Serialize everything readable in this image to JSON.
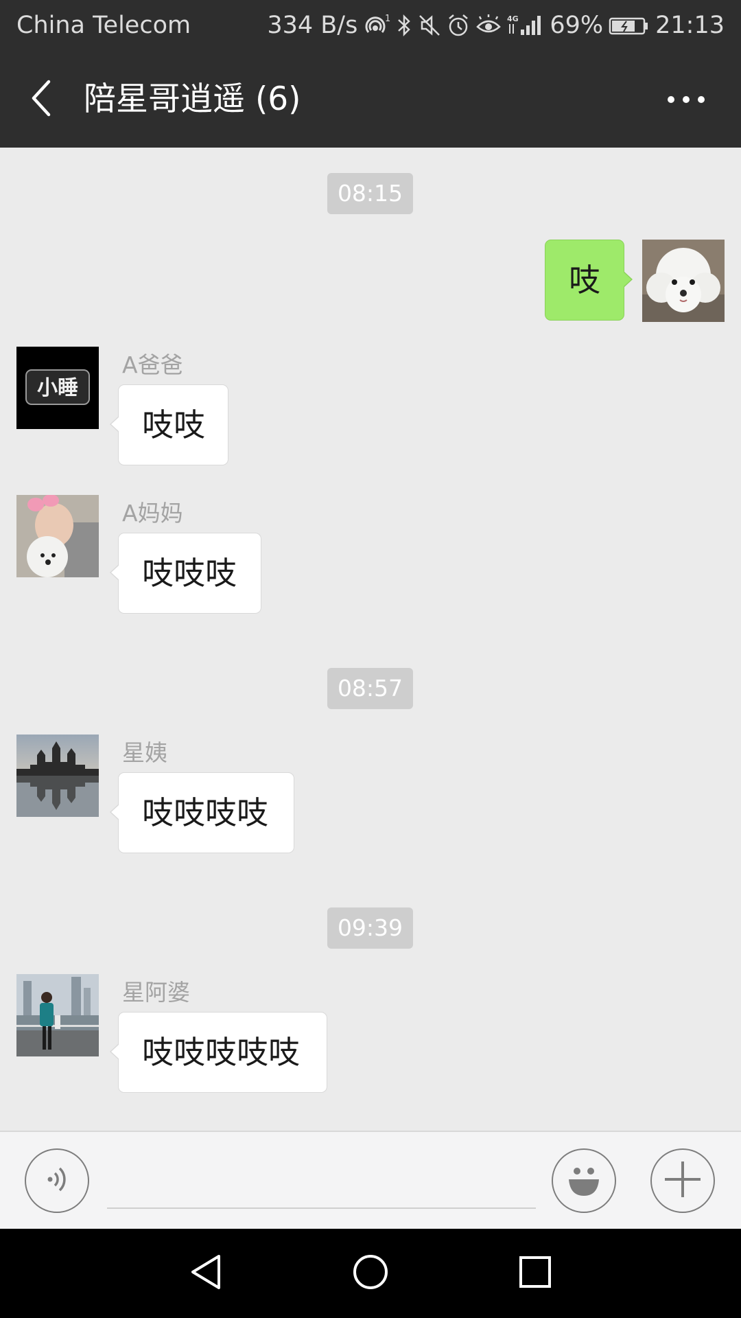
{
  "status_bar": {
    "carrier": "China Telecom",
    "speed": "334 B/s",
    "battery": "69%",
    "time": "21:13",
    "icons": [
      "hotspot-icon",
      "bluetooth-icon",
      "mute-icon",
      "alarm-icon",
      "eye-icon",
      "signal-4g-icon",
      "battery-icon"
    ]
  },
  "header": {
    "title": "陪星哥逍遥 (6)",
    "back_icon": "back-arrow-icon",
    "more_icon": "more-dots-icon"
  },
  "chat": {
    "timestamps": [
      "08:15",
      "08:57",
      "09:39"
    ],
    "messages": [
      {
        "sender": "",
        "text": "吱",
        "mine": true,
        "avatar": "poodle-avatar"
      },
      {
        "sender": "A爸爸",
        "text": "吱吱",
        "mine": false,
        "avatar": "sleep-text-avatar",
        "avatar_text": "小睡"
      },
      {
        "sender": "A妈妈",
        "text": "吱吱吱",
        "mine": false,
        "avatar": "woman-with-dog-avatar"
      },
      {
        "sender": "星姨",
        "text": "吱吱吱吱",
        "mine": false,
        "avatar": "temple-reflection-avatar"
      },
      {
        "sender": "星阿婆",
        "text": "吱吱吱吱吱",
        "mine": false,
        "avatar": "lady-riverside-avatar"
      }
    ]
  },
  "input_bar": {
    "value": "",
    "placeholder": "",
    "voice_icon": "voice-icon",
    "emoji_icon": "emoji-icon",
    "add_icon": "plus-icon"
  },
  "nav_bar": {
    "icons": [
      "nav-back-icon",
      "nav-home-icon",
      "nav-recents-icon"
    ]
  },
  "colors": {
    "header_bg": "#2e2e2e",
    "chat_bg": "#ebebeb",
    "my_bubble": "#9eea6a",
    "their_bubble": "#ffffff",
    "timestamp_bg": "#cecece"
  }
}
